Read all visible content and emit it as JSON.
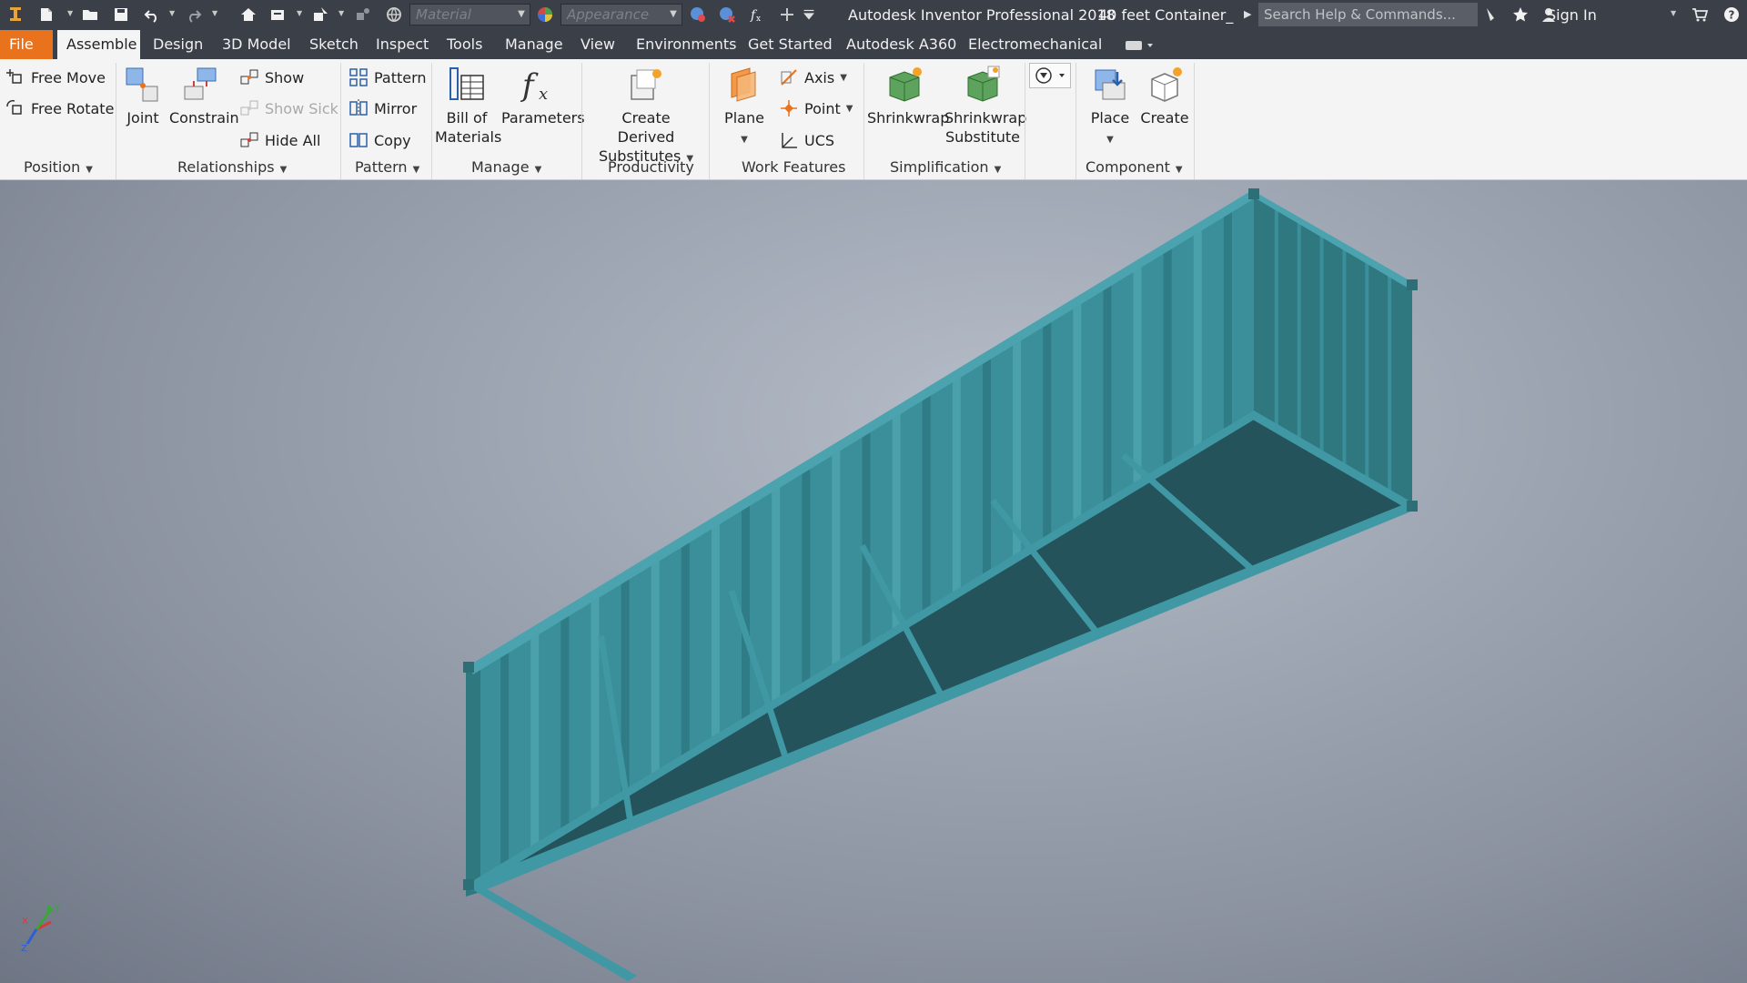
{
  "titlebar": {
    "material_placeholder": "Material",
    "appearance_placeholder": "Appearance",
    "app_title": "Autodesk Inventor Professional 2018",
    "document_title": "40 feet Container_",
    "search_placeholder": "Search Help & Commands...",
    "sign_in": "Sign In"
  },
  "tabs": [
    "File",
    "Assemble",
    "Design",
    "3D Model",
    "Sketch",
    "Inspect",
    "Tools",
    "Manage",
    "View",
    "Environments",
    "Get Started",
    "Autodesk A360",
    "Electromechanical"
  ],
  "active_tab": "Assemble",
  "ribbon": {
    "position": {
      "free_move": "Free Move",
      "free_rotate": "Free Rotate",
      "label": "Position"
    },
    "relationships": {
      "joint": "Joint",
      "constrain": "Constrain",
      "show": "Show",
      "show_sick": "Show Sick",
      "hide_all": "Hide All",
      "label": "Relationships"
    },
    "pattern": {
      "pattern": "Pattern",
      "mirror": "Mirror",
      "copy": "Copy",
      "label": "Pattern"
    },
    "manage": {
      "bom_line1": "Bill of",
      "bom_line2": "Materials",
      "parameters": "Parameters",
      "label": "Manage"
    },
    "productivity": {
      "line1": "Create Derived",
      "line2": "Substitutes",
      "label": "Productivity"
    },
    "work_features": {
      "plane": "Plane",
      "axis": "Axis",
      "point": "Point",
      "ucs": "UCS",
      "label": "Work Features"
    },
    "simplification": {
      "shrinkwrap": "Shrinkwrap",
      "sub_line1": "Shrinkwrap",
      "sub_line2": "Substitute",
      "label": "Simplification"
    },
    "component": {
      "place": "Place",
      "create": "Create",
      "label": "Component"
    }
  },
  "viewport": {
    "model": "40 feet container",
    "model_color": "#3a8f9a",
    "triad_labels": {
      "x": "X",
      "y": "Y",
      "z": "Z"
    }
  },
  "colors": {
    "title_bg": "#3b3f48",
    "file_tab": "#e8731c",
    "ribbon_bg": "#f4f4f4",
    "container_side": "#3a8f9a",
    "container_end": "#2f7880",
    "container_floor": "#24535b"
  }
}
